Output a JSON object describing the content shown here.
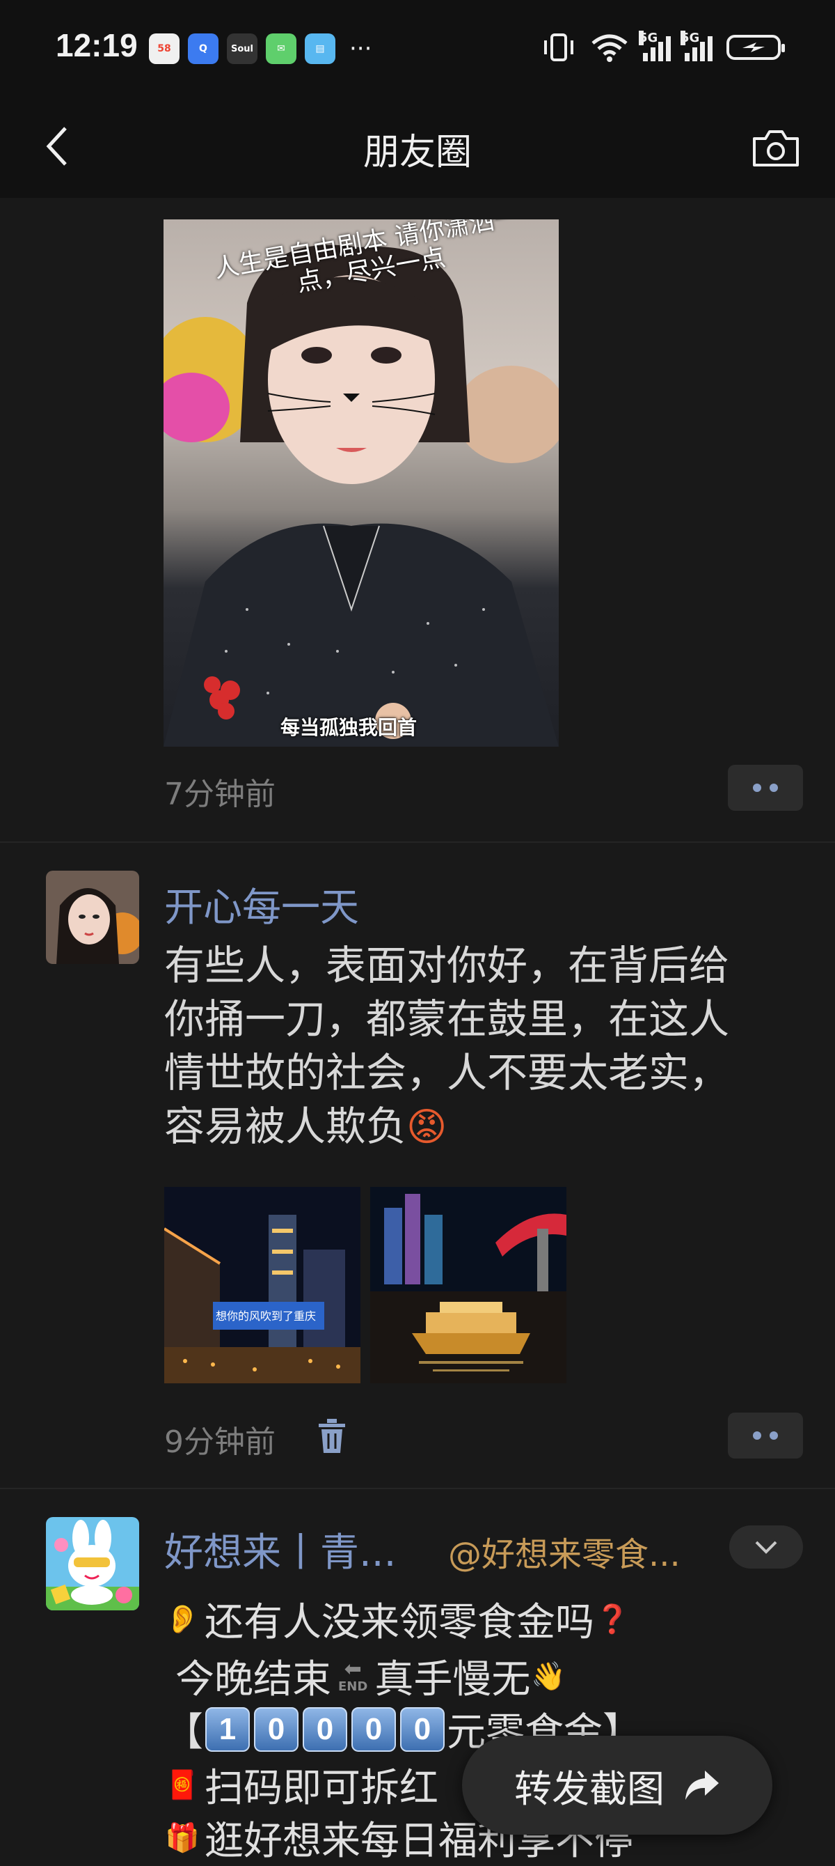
{
  "status_bar": {
    "time": "12:19",
    "app_icons": [
      "58-app-icon",
      "qq-app-icon",
      "soul-app-icon",
      "chat-app-icon",
      "book-app-icon"
    ],
    "soul_label": "Soul",
    "more": "···",
    "network_1": "5G",
    "network_2": "5G"
  },
  "navbar": {
    "title": "朋友圈"
  },
  "posts": [
    {
      "photo_caption_top": "人生是自由剧本 请你潇洒一点，尽兴一点",
      "photo_caption_bottom": "每当孤独我回首",
      "timestamp": "7分钟前"
    },
    {
      "username": "开心每一天",
      "text_lines": [
        "有些人，表面对你好，在背后给",
        "你捅一刀，都蒙在鼓里，在这人",
        "情世故的社会，人不要太老实，",
        "容易被人欺负"
      ],
      "angry_emoji": "😡",
      "thumb_sign": "想你的风吹到了重庆",
      "timestamp": "9分钟前"
    },
    {
      "username": "好想来丨青...",
      "mention": "@好想来零食...",
      "lines": {
        "l1_emoji": "👂",
        "l1": "还有人没来领零食金吗",
        "l1_tail": "❓",
        "l2": "今晚结束",
        "l2_end": "END",
        "l2b": "真手慢无",
        "l2_tail": "👋",
        "l3_open": "【",
        "l3_digits": [
          "1",
          "0",
          "0",
          "0",
          "0"
        ],
        "l3_text": "元零食金】",
        "l4_emoji": "🧧",
        "l4": "扫码即可拆红",
        "l5_emoji": "🎁",
        "l5": "逛好想来每日福利享不停"
      }
    }
  ],
  "share_button": {
    "label": "转发截图"
  }
}
